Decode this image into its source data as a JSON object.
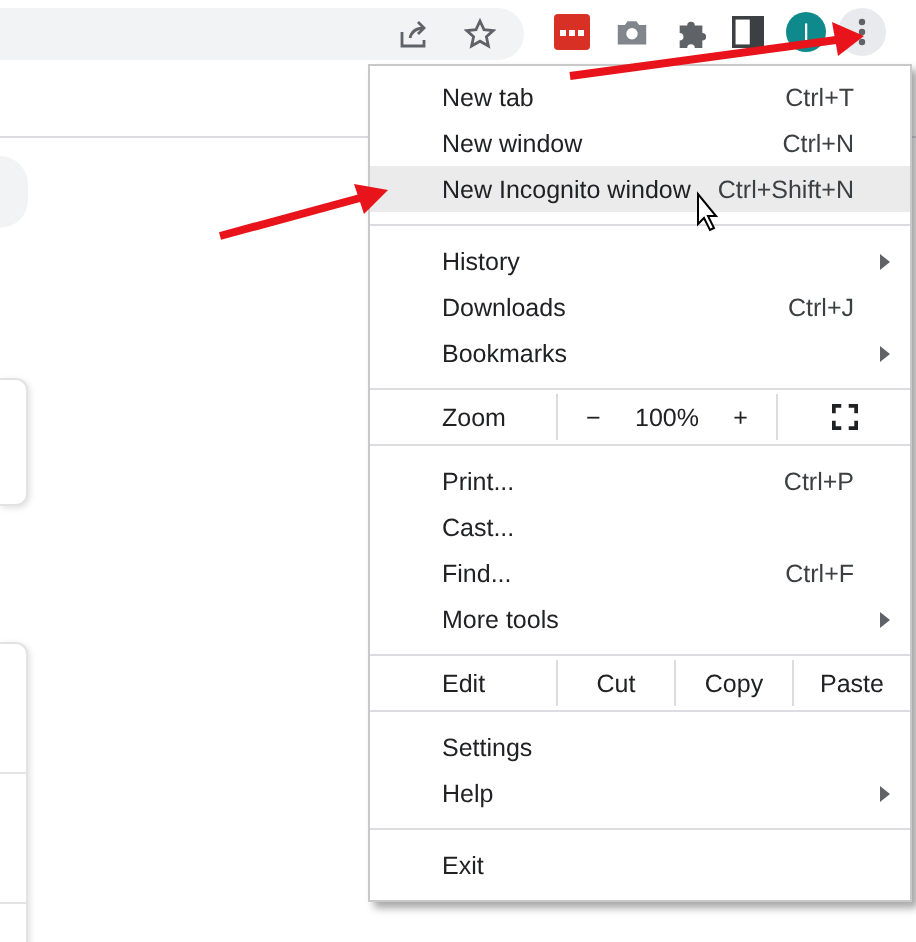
{
  "toolbar": {
    "avatar_initial": "I"
  },
  "menu": {
    "sections": [
      [
        {
          "kind": "item",
          "label": "New tab",
          "shortcut": "Ctrl+T",
          "submenu": false,
          "selected": false
        },
        {
          "kind": "item",
          "label": "New window",
          "shortcut": "Ctrl+N",
          "submenu": false,
          "selected": false
        },
        {
          "kind": "item",
          "label": "New Incognito window",
          "shortcut": "Ctrl+Shift+N",
          "submenu": false,
          "selected": true
        }
      ],
      [
        {
          "kind": "item",
          "label": "History",
          "submenu": true,
          "selected": false
        },
        {
          "kind": "item",
          "label": "Downloads",
          "shortcut": "Ctrl+J",
          "submenu": false,
          "selected": false
        },
        {
          "kind": "item",
          "label": "Bookmarks",
          "submenu": true,
          "selected": false
        }
      ],
      [
        {
          "kind": "zoom",
          "label": "Zoom",
          "minus": "−",
          "value": "100%",
          "plus": "+"
        }
      ],
      [
        {
          "kind": "item",
          "label": "Print...",
          "shortcut": "Ctrl+P",
          "submenu": false,
          "selected": false
        },
        {
          "kind": "item",
          "label": "Cast...",
          "submenu": false,
          "selected": false
        },
        {
          "kind": "item",
          "label": "Find...",
          "shortcut": "Ctrl+F",
          "submenu": false,
          "selected": false
        },
        {
          "kind": "item",
          "label": "More tools",
          "submenu": true,
          "selected": false
        }
      ],
      [
        {
          "kind": "edit",
          "label": "Edit",
          "buttons": [
            "Cut",
            "Copy",
            "Paste"
          ]
        }
      ],
      [
        {
          "kind": "item",
          "label": "Settings",
          "submenu": false,
          "selected": false
        },
        {
          "kind": "item",
          "label": "Help",
          "submenu": true,
          "selected": false
        }
      ],
      [
        {
          "kind": "item",
          "label": "Exit",
          "submenu": false,
          "selected": false
        }
      ]
    ]
  }
}
